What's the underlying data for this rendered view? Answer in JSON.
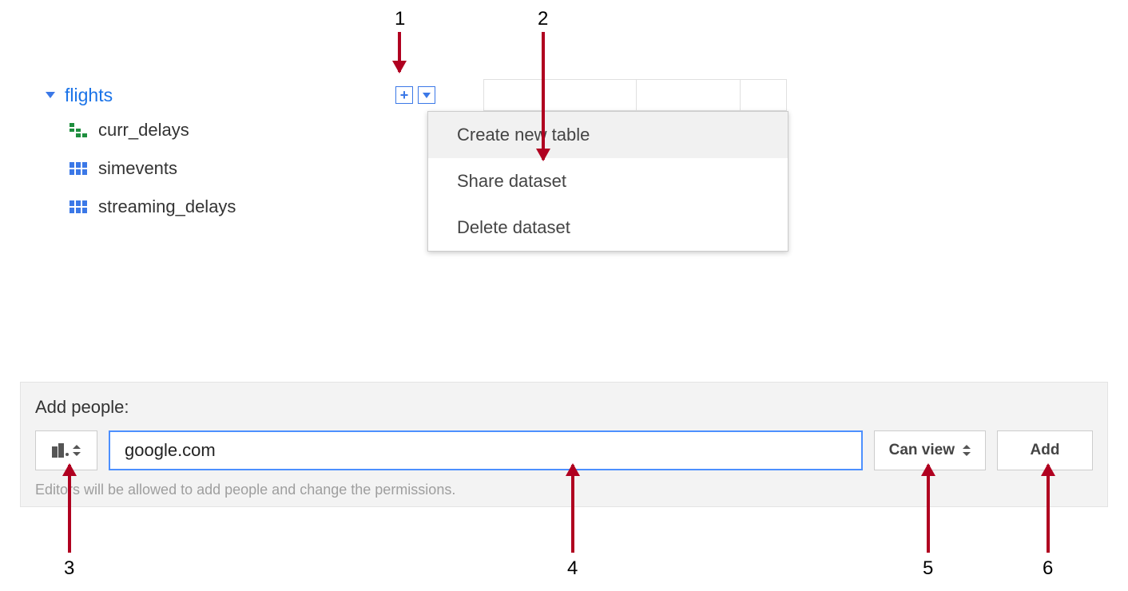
{
  "navigator": {
    "dataset_name": "flights",
    "tables": [
      {
        "name": "curr_delays",
        "kind": "view"
      },
      {
        "name": "simevents",
        "kind": "table"
      },
      {
        "name": "streaming_delays",
        "kind": "table"
      }
    ]
  },
  "menu": {
    "items": [
      {
        "label": "Create new table",
        "highlighted": true
      },
      {
        "label": "Share dataset",
        "highlighted": false
      },
      {
        "label": "Delete dataset",
        "highlighted": false
      }
    ]
  },
  "share": {
    "title": "Add people:",
    "input_value": "google.com",
    "permission_label": "Can view",
    "add_label": "Add",
    "helper": "Editors will be allowed to add people and change the permissions."
  },
  "callouts": {
    "n1": "1",
    "n2": "2",
    "n3": "3",
    "n4": "4",
    "n5": "5",
    "n6": "6"
  }
}
